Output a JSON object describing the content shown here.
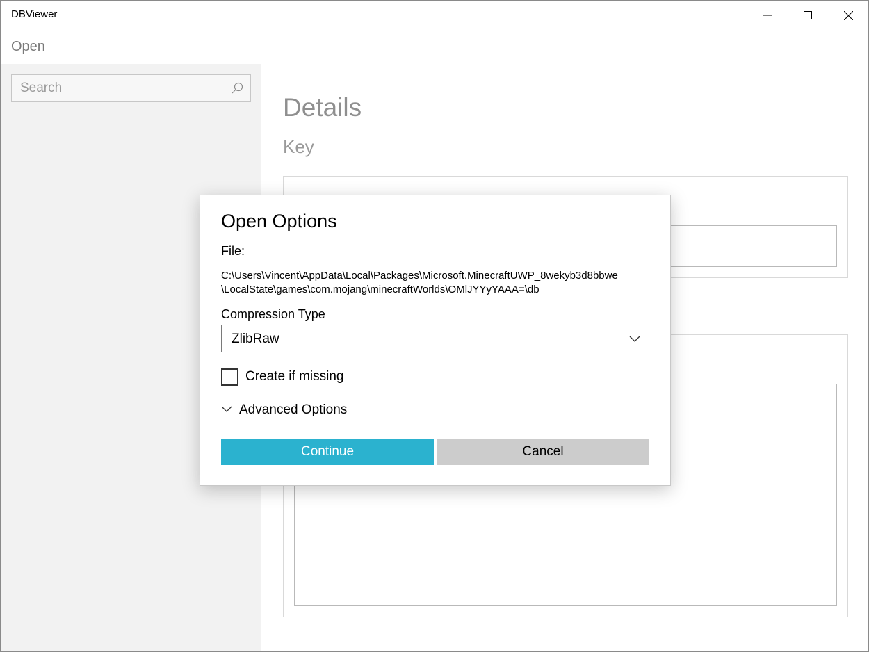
{
  "window": {
    "title": "DBViewer",
    "controls": [
      "minimize-icon",
      "maximize-icon",
      "close-icon"
    ]
  },
  "menu": {
    "open_label": "Open"
  },
  "sidebar": {
    "search": {
      "placeholder": "Search",
      "value": ""
    },
    "icon": "search-icon"
  },
  "details": {
    "title": "Details",
    "key_label": "Key"
  },
  "dialog": {
    "title": "Open Options",
    "file_label": "File:",
    "file_path_line1": "C:\\Users\\Vincent\\AppData\\Local\\Packages\\Microsoft.MinecraftUWP_8wekyb3d8bbwe",
    "file_path_line2": "\\LocalState\\games\\com.mojang\\minecraftWorlds\\OMlJYYyYAAA=\\db",
    "compression_label": "Compression Type",
    "compression_value": "ZlibRaw",
    "create_if_missing_label": "Create if missing",
    "create_if_missing_checked": false,
    "advanced_label": "Advanced Options",
    "continue_label": "Continue",
    "cancel_label": "Cancel",
    "accent_color": "#2bb2cf"
  }
}
